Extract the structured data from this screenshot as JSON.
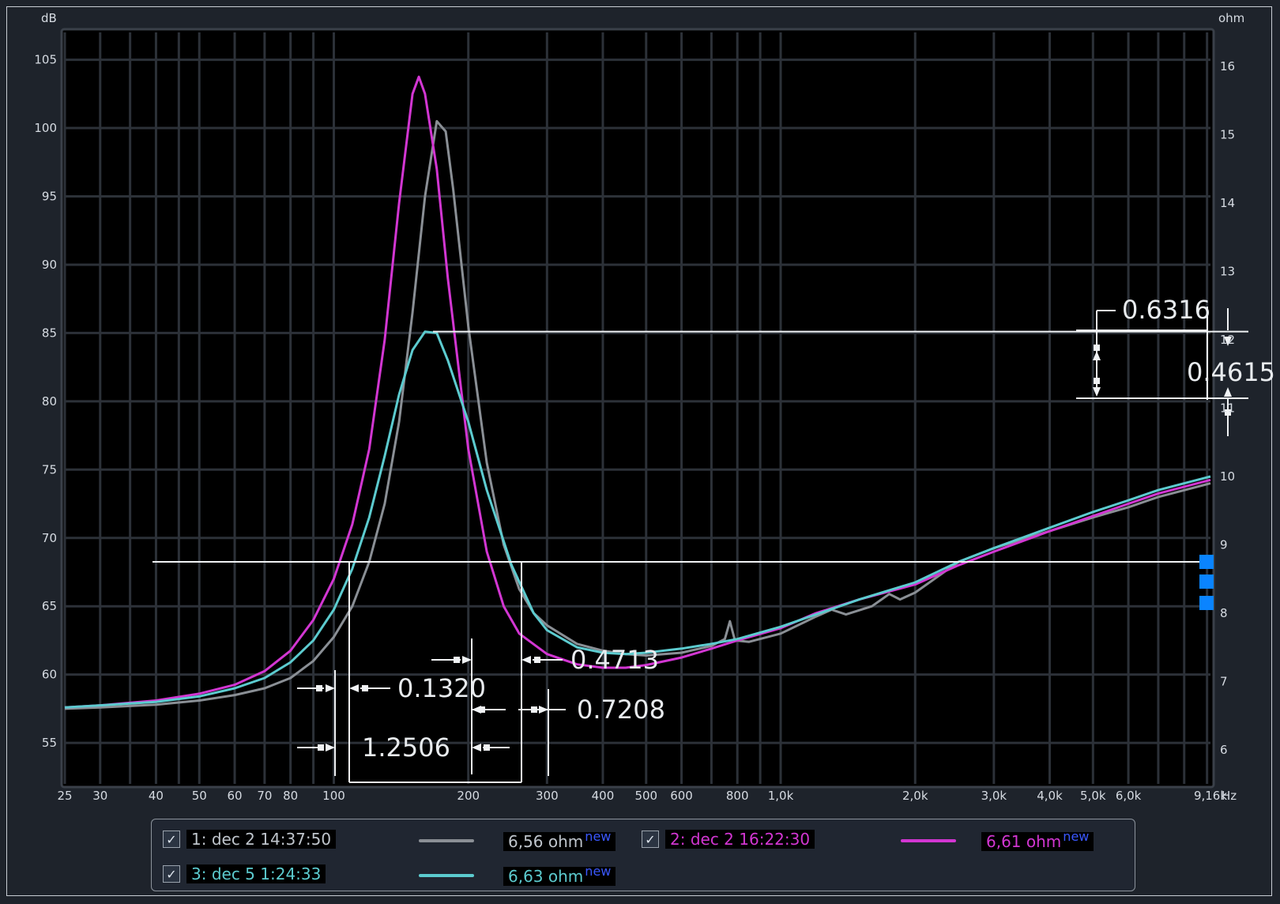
{
  "chart_data": {
    "type": "line",
    "x_scale": "log",
    "xlim": [
      25,
      9160
    ],
    "y_left": {
      "unit": "dB",
      "min": 52,
      "max": 107,
      "ticks": [
        55,
        60,
        65,
        70,
        75,
        80,
        85,
        90,
        95,
        100,
        105
      ]
    },
    "y_right": {
      "unit": "ohm",
      "min": 5.5,
      "max": 16.5,
      "ticks": [
        6,
        7,
        8,
        9,
        10,
        11,
        12,
        13,
        14,
        15,
        16
      ]
    },
    "x_ticks": [
      {
        "v": 25,
        "label": "25"
      },
      {
        "v": 30,
        "label": "30"
      },
      {
        "v": 40,
        "label": "40"
      },
      {
        "v": 50,
        "label": "50"
      },
      {
        "v": 60,
        "label": "60"
      },
      {
        "v": 70,
        "label": "70"
      },
      {
        "v": 80,
        "label": "80"
      },
      {
        "v": 100,
        "label": "100"
      },
      {
        "v": 200,
        "label": "200"
      },
      {
        "v": 300,
        "label": "300"
      },
      {
        "v": 400,
        "label": "400"
      },
      {
        "v": 500,
        "label": "500"
      },
      {
        "v": 600,
        "label": "600"
      },
      {
        "v": 800,
        "label": "800"
      },
      {
        "v": 1000,
        "label": "1,0k"
      },
      {
        "v": 2000,
        "label": "2,0k"
      },
      {
        "v": 3000,
        "label": "3,0k"
      },
      {
        "v": 4000,
        "label": "4,0k"
      },
      {
        "v": 5000,
        "label": "5,0k"
      },
      {
        "v": 6000,
        "label": "6,0k"
      },
      {
        "v": 9160,
        "label": "9,16k"
      }
    ],
    "x_unit": "Hz",
    "grid": true,
    "series": [
      {
        "name": "1: dec 2 14:37:50",
        "color": "#8a8f95",
        "points": [
          [
            25,
            6.6
          ],
          [
            30,
            6.62
          ],
          [
            40,
            6.66
          ],
          [
            50,
            6.72
          ],
          [
            60,
            6.8
          ],
          [
            70,
            6.9
          ],
          [
            80,
            7.05
          ],
          [
            90,
            7.3
          ],
          [
            100,
            7.65
          ],
          [
            110,
            8.1
          ],
          [
            120,
            8.75
          ],
          [
            130,
            9.6
          ],
          [
            140,
            10.8
          ],
          [
            150,
            12.4
          ],
          [
            160,
            14.1
          ],
          [
            170,
            15.2
          ],
          [
            178,
            15.05
          ],
          [
            185,
            14.2
          ],
          [
            200,
            12.2
          ],
          [
            220,
            10.2
          ],
          [
            240,
            9.0
          ],
          [
            260,
            8.35
          ],
          [
            280,
            8.0
          ],
          [
            300,
            7.82
          ],
          [
            350,
            7.55
          ],
          [
            400,
            7.45
          ],
          [
            450,
            7.4
          ],
          [
            500,
            7.38
          ],
          [
            600,
            7.42
          ],
          [
            700,
            7.52
          ],
          [
            750,
            7.62
          ],
          [
            770,
            7.88
          ],
          [
            790,
            7.6
          ],
          [
            850,
            7.58
          ],
          [
            1000,
            7.7
          ],
          [
            1200,
            7.95
          ],
          [
            1300,
            8.05
          ],
          [
            1400,
            7.98
          ],
          [
            1600,
            8.1
          ],
          [
            1750,
            8.28
          ],
          [
            1850,
            8.2
          ],
          [
            2000,
            8.3
          ],
          [
            2500,
            8.75
          ],
          [
            3000,
            8.95
          ],
          [
            4000,
            9.2
          ],
          [
            5000,
            9.4
          ],
          [
            6000,
            9.55
          ],
          [
            7000,
            9.7
          ],
          [
            9160,
            9.9
          ]
        ]
      },
      {
        "name": "2: dec 2 16:22:30",
        "color": "#d236d2",
        "points": [
          [
            25,
            6.62
          ],
          [
            30,
            6.65
          ],
          [
            40,
            6.72
          ],
          [
            50,
            6.82
          ],
          [
            60,
            6.95
          ],
          [
            70,
            7.15
          ],
          [
            80,
            7.45
          ],
          [
            90,
            7.9
          ],
          [
            100,
            8.5
          ],
          [
            110,
            9.3
          ],
          [
            120,
            10.4
          ],
          [
            130,
            12.0
          ],
          [
            140,
            14.0
          ],
          [
            150,
            15.6
          ],
          [
            155,
            15.85
          ],
          [
            160,
            15.6
          ],
          [
            170,
            14.5
          ],
          [
            180,
            12.9
          ],
          [
            200,
            10.4
          ],
          [
            220,
            8.9
          ],
          [
            240,
            8.1
          ],
          [
            260,
            7.7
          ],
          [
            300,
            7.4
          ],
          [
            350,
            7.25
          ],
          [
            400,
            7.2
          ],
          [
            450,
            7.2
          ],
          [
            500,
            7.24
          ],
          [
            600,
            7.35
          ],
          [
            700,
            7.48
          ],
          [
            800,
            7.6
          ],
          [
            1000,
            7.78
          ],
          [
            1200,
            8.0
          ],
          [
            1500,
            8.2
          ],
          [
            2000,
            8.42
          ],
          [
            2500,
            8.7
          ],
          [
            3000,
            8.9
          ],
          [
            4000,
            9.2
          ],
          [
            5000,
            9.42
          ],
          [
            6000,
            9.6
          ],
          [
            7000,
            9.75
          ],
          [
            9160,
            9.95
          ]
        ]
      },
      {
        "name": "3: dec 5 1:24:33",
        "color": "#5ccbcf",
        "points": [
          [
            25,
            6.62
          ],
          [
            30,
            6.65
          ],
          [
            40,
            6.7
          ],
          [
            50,
            6.78
          ],
          [
            60,
            6.9
          ],
          [
            70,
            7.05
          ],
          [
            80,
            7.28
          ],
          [
            90,
            7.6
          ],
          [
            100,
            8.05
          ],
          [
            110,
            8.65
          ],
          [
            120,
            9.4
          ],
          [
            130,
            10.3
          ],
          [
            140,
            11.2
          ],
          [
            150,
            11.85
          ],
          [
            160,
            12.12
          ],
          [
            170,
            12.1
          ],
          [
            180,
            11.7
          ],
          [
            200,
            10.8
          ],
          [
            220,
            9.8
          ],
          [
            250,
            8.7
          ],
          [
            280,
            8.0
          ],
          [
            300,
            7.75
          ],
          [
            350,
            7.5
          ],
          [
            400,
            7.42
          ],
          [
            450,
            7.4
          ],
          [
            500,
            7.42
          ],
          [
            600,
            7.48
          ],
          [
            700,
            7.55
          ],
          [
            800,
            7.62
          ],
          [
            1000,
            7.8
          ],
          [
            1200,
            7.98
          ],
          [
            1500,
            8.2
          ],
          [
            2000,
            8.45
          ],
          [
            2500,
            8.75
          ],
          [
            3000,
            8.95
          ],
          [
            4000,
            9.25
          ],
          [
            5000,
            9.48
          ],
          [
            6000,
            9.65
          ],
          [
            7000,
            9.8
          ],
          [
            9160,
            10.0
          ]
        ]
      }
    ],
    "annotations": [
      {
        "label": "0.1320"
      },
      {
        "label": "0.4713"
      },
      {
        "label": "0.7208"
      },
      {
        "label": "1.2506"
      },
      {
        "label": "0.6316"
      },
      {
        "label": "0.4615"
      }
    ]
  },
  "legend": {
    "items": [
      {
        "label": "1: dec 2 14:37:50",
        "impedance": "6,56 ohm",
        "badge": "new",
        "color": "#8a8f95",
        "text_color": "#bfc5cc",
        "checked": true
      },
      {
        "label": "2: dec 2 16:22:30",
        "impedance": "6,61 ohm",
        "badge": "new",
        "color": "#d236d2",
        "text_color": "#d236d2",
        "checked": true
      },
      {
        "label": "3: dec 5 1:24:33",
        "impedance": "6,63 ohm",
        "badge": "new",
        "color": "#5ccbcf",
        "text_color": "#5ccbcf",
        "checked": true
      }
    ]
  },
  "colors": {
    "background": "#1e232b",
    "plot_background": "#000000",
    "grid": "#2a2f37",
    "marker": "#0a84ff"
  }
}
